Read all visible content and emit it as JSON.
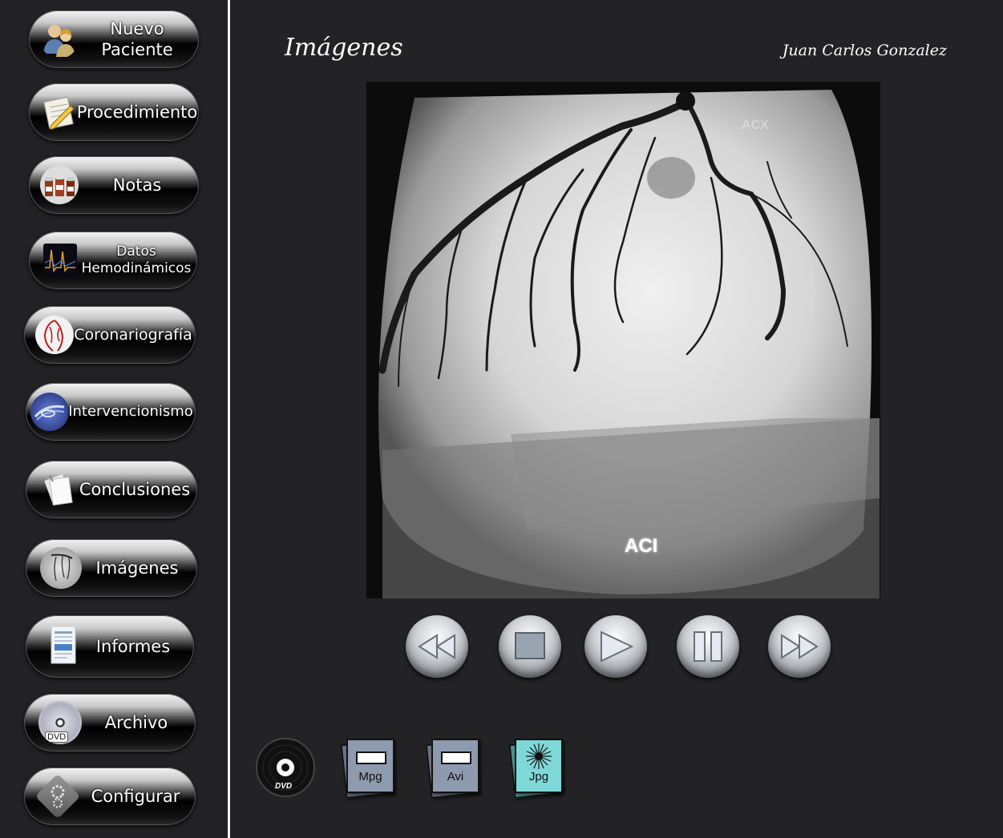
{
  "sidebar": {
    "items": [
      {
        "label_line1": "Nuevo",
        "label_line2": "Paciente",
        "icon": "users-icon"
      },
      {
        "label": "Procedimiento",
        "icon": "notepad-pencil-icon"
      },
      {
        "label": "Notas",
        "icon": "medicine-bottles-icon"
      },
      {
        "label_line1": "Datos",
        "label_line2": "Hemodinámicos",
        "icon": "waveform-icon"
      },
      {
        "label": "Coronariografía",
        "icon": "heart-vessels-icon"
      },
      {
        "label": "Intervencionismo",
        "icon": "catheter-icon"
      },
      {
        "label": "Conclusiones",
        "icon": "papers-icon"
      },
      {
        "label": "Imágenes",
        "icon": "angiogram-icon"
      },
      {
        "label": "Informes",
        "icon": "document-icon"
      },
      {
        "label": "Archivo",
        "icon": "dvd-icon",
        "badge": "DVD"
      },
      {
        "label": "Configurar",
        "icon": "gears-icon"
      }
    ]
  },
  "header": {
    "title": "Imágenes",
    "user": "Juan Carlos Gonzalez"
  },
  "viewer": {
    "overlay_label": "ACI",
    "top_label": "ACX"
  },
  "controls": [
    "rewind-icon",
    "stop-icon",
    "play-icon",
    "pause-icon",
    "fast-forward-icon"
  ],
  "export": {
    "dvd_label": "DVD",
    "mpg_label": "Mpg",
    "avi_label": "Avi",
    "jpg_label": "Jpg"
  },
  "colors": {
    "background": "#232325",
    "divider": "#f2f2f2",
    "jpg_tint": "#7fd8d8",
    "video_tint": "#8e9aae"
  }
}
